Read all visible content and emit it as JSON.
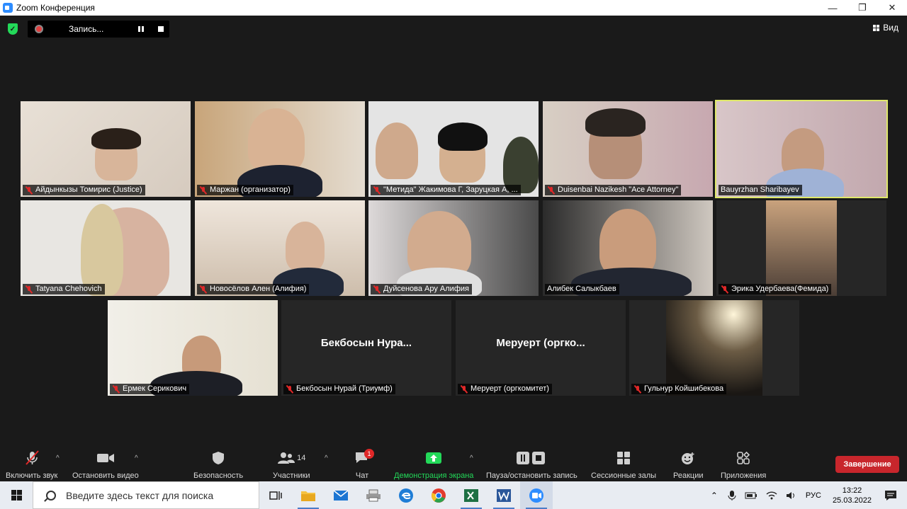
{
  "window": {
    "title": "Zoom Конференция",
    "minimize": "—",
    "maximize": "❐",
    "close": "✕"
  },
  "recording": {
    "label": "Запись..."
  },
  "view": {
    "label": "Вид"
  },
  "participants": [
    {
      "name": "Айдынкызы Томирис (Justice)",
      "muted": true
    },
    {
      "name": "Маржан (организатор)",
      "muted": true
    },
    {
      "name": "\"Метида\" Жакимова Г, Заруцкая А, ...",
      "muted": true
    },
    {
      "name": "Duisenbai Nazikesh \"Ace Attorney\"",
      "muted": true
    },
    {
      "name": "Bauyrzhan Sharibayev",
      "muted": false,
      "active": true
    },
    {
      "name": "Tatyana Chehovich",
      "muted": true
    },
    {
      "name": "Новосёлов Ален (Алифия)",
      "muted": true
    },
    {
      "name": "Дуйсенова Ару Алифия",
      "muted": true
    },
    {
      "name": "Алибек Салыкбаев",
      "muted": false
    },
    {
      "name": "Эрика Удербаева(Фемида)",
      "muted": true
    },
    {
      "name": "Ермек Серикович",
      "muted": true
    },
    {
      "name": "Бекбосын Нурай (Триумф)",
      "muted": true,
      "placeholder": "Бекбосын  Нура..."
    },
    {
      "name": "Меруерт (оргкомитет)",
      "muted": true,
      "placeholder": "Меруерт  (оргко..."
    },
    {
      "name": "Гульнур Койшибекова",
      "muted": true
    }
  ],
  "toolbar": {
    "unmute": "Включить звук",
    "stop_video": "Остановить видео",
    "security": "Безопасность",
    "participants": "Участники",
    "participants_count": "14",
    "chat": "Чат",
    "chat_badge": "1",
    "share": "Демонстрация экрана",
    "pause_record": "Пауза/остановить запись",
    "breakout": "Сессионные залы",
    "reactions": "Реакции",
    "apps": "Приложения",
    "end": "Завершение",
    "share_color": "#23d959",
    "end_color": "#c8262c"
  },
  "taskbar": {
    "search_placeholder": "Введите здесь текст для поиска",
    "lang": "РУС",
    "time": "13:22",
    "date": "25.03.2022"
  }
}
